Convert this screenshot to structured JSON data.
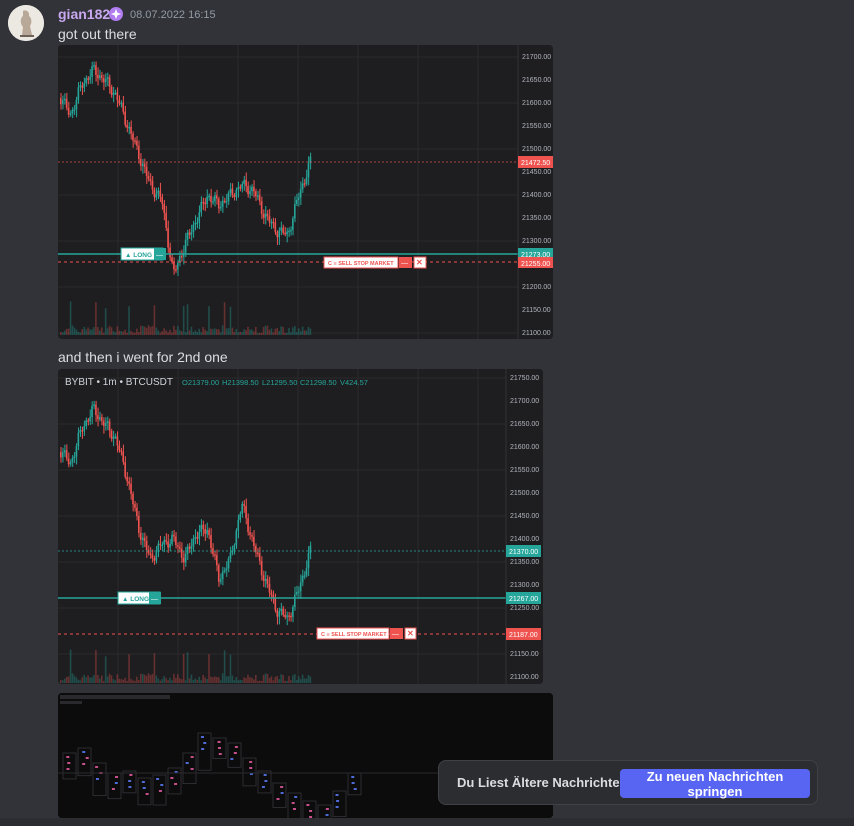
{
  "message": {
    "username": "gian182",
    "timestamp": "08.07.2022 16:15",
    "text1": "got out there",
    "text2": "and then i went for 2nd one"
  },
  "chart1": {
    "y_ticks": [
      "21700.00",
      "21650.00",
      "21600.00",
      "21550.00",
      "21500.00",
      "21450.00",
      "21400.00",
      "21350.00",
      "21300.00",
      "21250.00",
      "21200.00",
      "21150.00",
      "21100.00"
    ],
    "price_label": "21472.50",
    "long_price_label": "21273.00",
    "stop_price_label": "21255.00",
    "long_label": "▲ LONG",
    "stop_label": "C ≡ SELL STOP MARKET",
    "close_x": "✕",
    "minus": "—"
  },
  "chart2": {
    "header": "BYBIT • 1m • BTCUSDT",
    "ohlc_o": "O21379.00",
    "ohlc_h": "H21398.50",
    "ohlc_l": "L21295.50",
    "ohlc_c": "C21298.50",
    "ohlc_v": "V424.57",
    "y_ticks": [
      "21750.00",
      "21700.00",
      "21650.00",
      "21600.00",
      "21550.00",
      "21500.00",
      "21450.00",
      "21400.00",
      "21350.00",
      "21300.00",
      "21250.00",
      "21200.00",
      "21150.00",
      "21100.00"
    ],
    "price_label": "21370.00",
    "long_price_label": "21267.00",
    "stop_price_label": "21187.00",
    "long_label": "▲ LONG",
    "stop_label": "C ≡ SELL STOP MARKET",
    "close_x": "✕",
    "minus": "—"
  },
  "banner": {
    "text": "Du Liest Ältere Nachrichten",
    "button": "Zu neuen Nachrichten springen"
  },
  "colors": {
    "up": "#26a69a",
    "down": "#ef5350",
    "long_line": "#26a69a",
    "stop_line": "#ef5350",
    "accent": "#5865f2"
  }
}
